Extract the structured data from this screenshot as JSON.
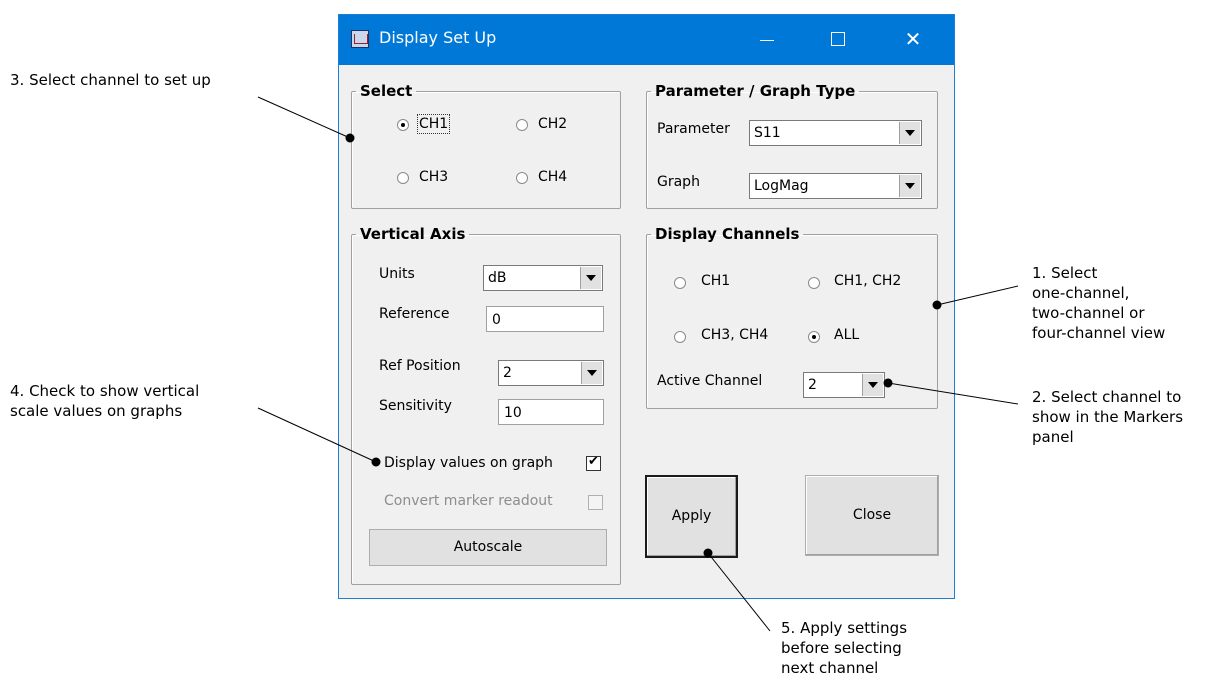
{
  "window": {
    "title": "Display Set Up",
    "controls": {
      "minimize": "—",
      "maximize": "☐",
      "close": "✕"
    }
  },
  "select": {
    "legend": "Select",
    "options": [
      {
        "label": "CH1",
        "checked": true
      },
      {
        "label": "CH2",
        "checked": false
      },
      {
        "label": "CH3",
        "checked": false
      },
      {
        "label": "CH4",
        "checked": false
      }
    ]
  },
  "param_graph": {
    "legend": "Parameter / Graph Type",
    "parameter_label": "Parameter",
    "parameter_value": "S11",
    "graph_label": "Graph",
    "graph_value": "LogMag"
  },
  "vertical_axis": {
    "legend": "Vertical Axis",
    "units_label": "Units",
    "units_value": "dB",
    "reference_label": "Reference",
    "reference_value": "0",
    "ref_position_label": "Ref Position",
    "ref_position_value": "2",
    "sensitivity_label": "Sensitivity",
    "sensitivity_value": "10",
    "display_values_label": "Display values on graph",
    "display_values_checked": true,
    "convert_marker_label": "Convert marker readout",
    "convert_marker_checked": false,
    "autoscale_label": "Autoscale"
  },
  "display_channels": {
    "legend": "Display Channels",
    "options": [
      {
        "label": "CH1",
        "checked": false
      },
      {
        "label": "CH1, CH2",
        "checked": false
      },
      {
        "label": "CH3, CH4",
        "checked": false
      },
      {
        "label": "ALL",
        "checked": true
      }
    ],
    "active_channel_label": "Active Channel",
    "active_channel_value": "2"
  },
  "buttons": {
    "apply": "Apply",
    "close": "Close"
  },
  "annotations": {
    "a1": "1. Select\none-channel,\ntwo-channel or\nfour-channel view",
    "a2": "2. Select channel to\nshow in the Markers\npanel",
    "a3": "3. Select channel to set up",
    "a4": "4. Check to show vertical\nscale values on graphs",
    "a5": "5. Apply settings\nbefore selecting\nnext channel"
  },
  "colors": {
    "titlebar": "#0078d7",
    "dialog_bg": "#f0f0f0"
  }
}
